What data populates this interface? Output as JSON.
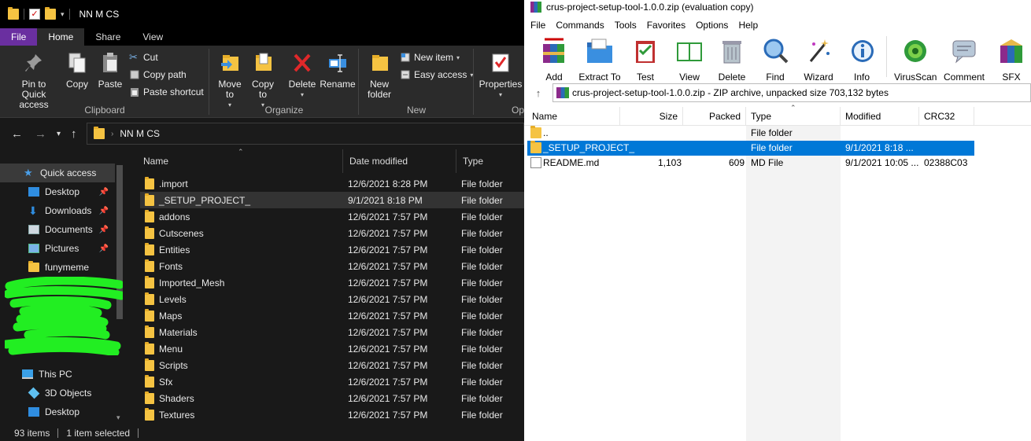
{
  "explorer": {
    "window_title": "NN M CS",
    "tabs": [
      "File",
      "Home",
      "Share",
      "View"
    ],
    "ribbon": {
      "clipboard": {
        "label": "Clipboard",
        "pin_to_quick_access": "Pin to Quick access",
        "copy": "Copy",
        "paste": "Paste",
        "cut": "Cut",
        "copy_path": "Copy path",
        "paste_shortcut": "Paste shortcut"
      },
      "organize": {
        "label": "Organize",
        "move_to": "Move to",
        "copy_to": "Copy to",
        "delete": "Delete",
        "rename": "Rename"
      },
      "new": {
        "label": "New",
        "new_folder": "New folder",
        "new_item": "New item",
        "easy_access": "Easy access"
      },
      "open": {
        "properties": "Properties",
        "label_partial": "Op"
      }
    },
    "address": {
      "path": "NN M CS"
    },
    "sidebar": {
      "items": [
        {
          "label": "Quick access",
          "icon": "star-icon",
          "pinned": false,
          "selected": true
        },
        {
          "label": "Desktop",
          "icon": "desktop-icon",
          "pinned": true
        },
        {
          "label": "Downloads",
          "icon": "download-icon",
          "pinned": true
        },
        {
          "label": "Documents",
          "icon": "documents-icon",
          "pinned": true
        },
        {
          "label": "Pictures",
          "icon": "pictures-icon",
          "pinned": true
        },
        {
          "label": "funymeme",
          "icon": "folder-icon",
          "pinned": false
        },
        {
          "label": "This PC",
          "icon": "computer-icon",
          "pinned": false
        },
        {
          "label": "3D Objects",
          "icon": "cube-icon",
          "pinned": false
        },
        {
          "label": "Desktop",
          "icon": "desktop-icon",
          "pinned": false
        }
      ]
    },
    "columns": {
      "name": "Name",
      "date_modified": "Date modified",
      "type": "Type"
    },
    "files": [
      {
        "name": ".import",
        "date": "12/6/2021 8:28 PM",
        "type": "File folder"
      },
      {
        "name": "_SETUP_PROJECT_",
        "date": "9/1/2021 8:18 PM",
        "type": "File folder",
        "selected": true
      },
      {
        "name": "addons",
        "date": "12/6/2021 7:57 PM",
        "type": "File folder"
      },
      {
        "name": "Cutscenes",
        "date": "12/6/2021 7:57 PM",
        "type": "File folder"
      },
      {
        "name": "Entities",
        "date": "12/6/2021 7:57 PM",
        "type": "File folder"
      },
      {
        "name": "Fonts",
        "date": "12/6/2021 7:57 PM",
        "type": "File folder"
      },
      {
        "name": "Imported_Mesh",
        "date": "12/6/2021 7:57 PM",
        "type": "File folder"
      },
      {
        "name": "Levels",
        "date": "12/6/2021 7:57 PM",
        "type": "File folder"
      },
      {
        "name": "Maps",
        "date": "12/6/2021 7:57 PM",
        "type": "File folder"
      },
      {
        "name": "Materials",
        "date": "12/6/2021 7:57 PM",
        "type": "File folder"
      },
      {
        "name": "Menu",
        "date": "12/6/2021 7:57 PM",
        "type": "File folder"
      },
      {
        "name": "Scripts",
        "date": "12/6/2021 7:57 PM",
        "type": "File folder"
      },
      {
        "name": "Sfx",
        "date": "12/6/2021 7:57 PM",
        "type": "File folder"
      },
      {
        "name": "Shaders",
        "date": "12/6/2021 7:57 PM",
        "type": "File folder"
      },
      {
        "name": "Textures",
        "date": "12/6/2021 7:57 PM",
        "type": "File folder"
      }
    ],
    "status": {
      "item_count": "93 items",
      "selection": "1 item selected"
    },
    "colors": {
      "background": "#191919",
      "file_tab": "#6a2fa0",
      "folder": "#f5c342"
    }
  },
  "winrar": {
    "window_title": "crus-project-setup-tool-1.0.0.zip (evaluation copy)",
    "menu": [
      "File",
      "Commands",
      "Tools",
      "Favorites",
      "Options",
      "Help"
    ],
    "toolbar": [
      {
        "label": "Add",
        "icon": "add-archive-icon"
      },
      {
        "label": "Extract To",
        "icon": "extract-folder-icon"
      },
      {
        "label": "Test",
        "icon": "test-clipboard-icon"
      },
      {
        "label": "View",
        "icon": "view-book-icon"
      },
      {
        "label": "Delete",
        "icon": "trash-icon"
      },
      {
        "label": "Find",
        "icon": "magnifier-icon"
      },
      {
        "label": "Wizard",
        "icon": "wand-icon"
      },
      {
        "label": "Info",
        "icon": "info-icon"
      },
      {
        "label": "VirusScan",
        "icon": "virus-icon"
      },
      {
        "label": "Comment",
        "icon": "comment-icon"
      },
      {
        "label": "SFX",
        "icon": "sfx-icon"
      }
    ],
    "path": "crus-project-setup-tool-1.0.0.zip - ZIP archive, unpacked size 703,132 bytes",
    "columns": {
      "name": "Name",
      "size": "Size",
      "packed": "Packed",
      "type": "Type",
      "modified": "Modified",
      "crc": "CRC32"
    },
    "rows": [
      {
        "name": "..",
        "size": "",
        "packed": "",
        "type": "File folder",
        "modified": "",
        "crc": "",
        "icon": "folder"
      },
      {
        "name": "_SETUP_PROJECT_",
        "size": "",
        "packed": "",
        "type": "File folder",
        "modified": "9/1/2021 8:18 ...",
        "crc": "",
        "icon": "folder",
        "selected": true
      },
      {
        "name": "README.md",
        "size": "1,103",
        "packed": "609",
        "type": "MD File",
        "modified": "9/1/2021 10:05 ...",
        "crc": "02388C03",
        "icon": "file"
      }
    ],
    "colors": {
      "selection": "#0078d7"
    }
  }
}
